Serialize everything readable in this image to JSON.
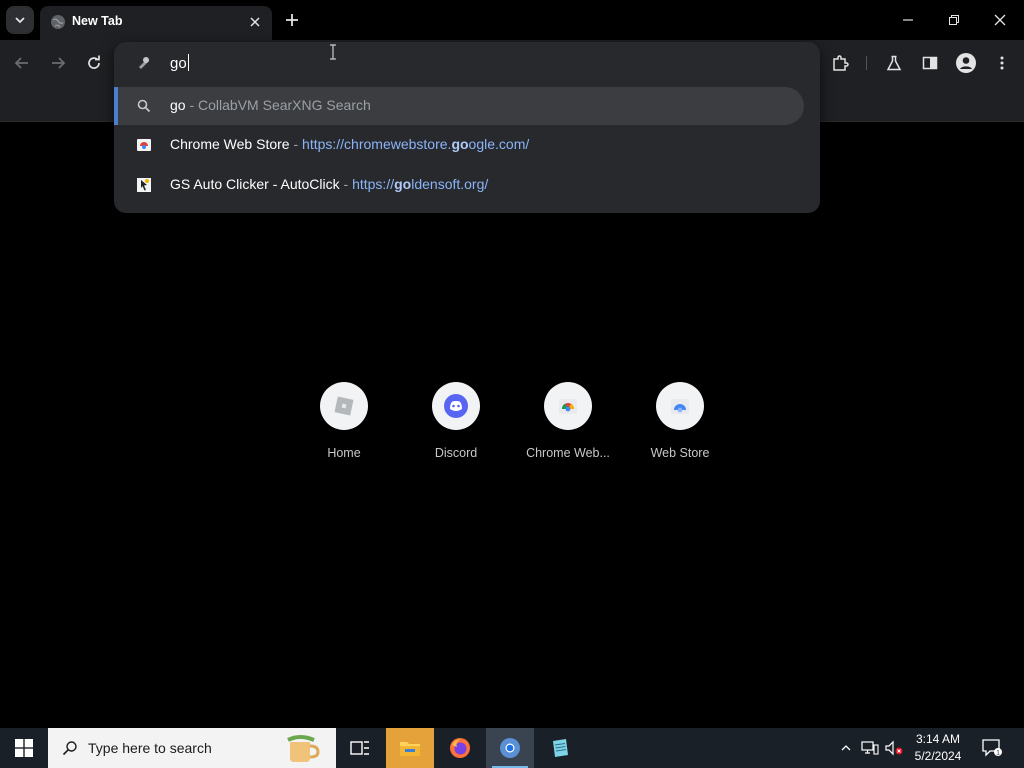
{
  "browser": {
    "tab_title": "New Tab",
    "omnibox_text": "go"
  },
  "suggestions": [
    {
      "query": "go",
      "separator": " - ",
      "source": "CollabVM SearXNG Search"
    },
    {
      "title": "Chrome Web Store",
      "separator": " - ",
      "url_pre": "https://chromewebstore.",
      "url_match": "go",
      "url_post": "ogle.com/"
    },
    {
      "title": "GS Auto Clicker - AutoClick",
      "separator": " - ",
      "url_pre": "https://",
      "url_match": "go",
      "url_post": "ldensoft.org/"
    }
  ],
  "shortcuts": [
    {
      "label": "Home",
      "icon": "roblox-icon"
    },
    {
      "label": "Discord",
      "icon": "discord-icon"
    },
    {
      "label": "Chrome Web...",
      "icon": "chrome-web-store-icon"
    },
    {
      "label": "Web Store",
      "icon": "web-store-icon"
    }
  ],
  "taskbar": {
    "search_placeholder": "Type here to search",
    "time": "3:14 AM",
    "date": "5/2/2024"
  },
  "colors": {
    "accent": "#4a7fd0",
    "link": "#8ab4f8",
    "taskbar_bg": "#1a2027"
  }
}
